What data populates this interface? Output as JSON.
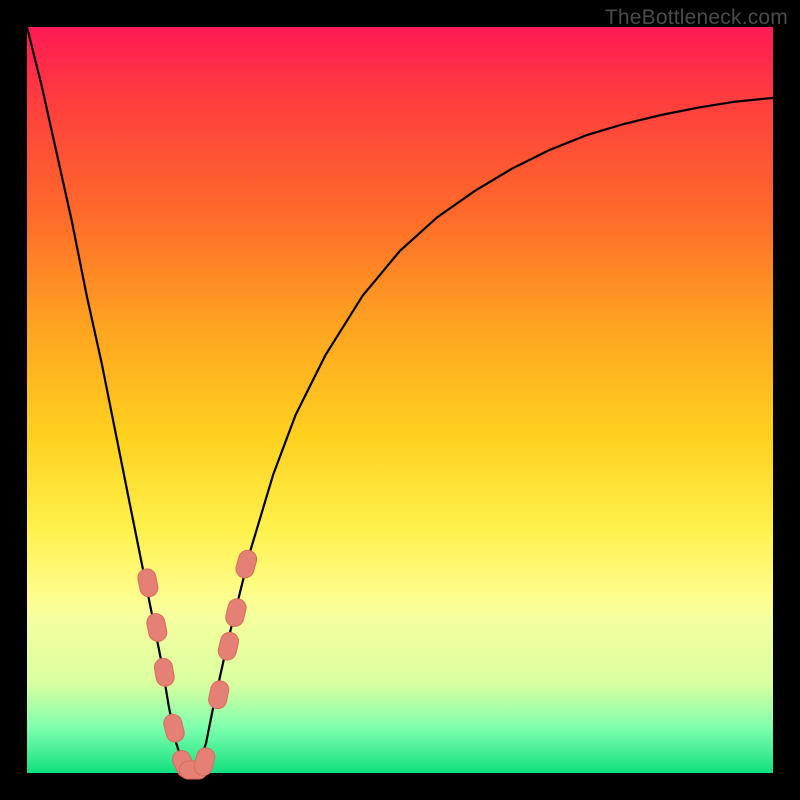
{
  "watermark": "TheBottleneck.com",
  "colors": {
    "frame": "#000000",
    "curve": "#000000",
    "marker_fill": "#e58074",
    "marker_stroke": "#d86b5f",
    "gradient_stops": [
      "#ff1a55",
      "#ff3e3e",
      "#ff6a2a",
      "#ffa321",
      "#ffd11f",
      "#fff04a",
      "#fffd8c",
      "#f5ff9e",
      "#d9ffa0",
      "#7dffad",
      "#12e07e"
    ]
  },
  "chart_data": {
    "type": "line",
    "title": "",
    "xlabel": "",
    "ylabel": "",
    "xlim": [
      0,
      100
    ],
    "ylim": [
      0,
      100
    ],
    "legend": false,
    "grid": false,
    "series": [
      {
        "name": "bottleneck-curve",
        "x": [
          0,
          2,
          4,
          6,
          8,
          10,
          12,
          14,
          16,
          17,
          18,
          19,
          20,
          21,
          22,
          23,
          24,
          25,
          27,
          30,
          33,
          36,
          40,
          45,
          50,
          55,
          60,
          65,
          70,
          75,
          80,
          85,
          90,
          95,
          100
        ],
        "y": [
          100,
          92,
          83,
          74,
          64,
          55,
          45,
          35,
          25,
          20,
          15,
          9,
          4,
          1,
          0,
          1,
          4,
          9,
          18,
          30,
          40,
          48,
          56,
          64,
          70,
          74.5,
          78,
          81,
          83.5,
          85.5,
          87,
          88.2,
          89.2,
          90,
          90.5
        ]
      }
    ],
    "markers": [
      {
        "name": "left-dot-1",
        "x": 16.2,
        "y": 25.5
      },
      {
        "name": "left-dot-2",
        "x": 17.4,
        "y": 19.5
      },
      {
        "name": "left-dot-3",
        "x": 18.4,
        "y": 13.5
      },
      {
        "name": "left-dot-4",
        "x": 19.7,
        "y": 6.0
      },
      {
        "name": "min-dot-1",
        "x": 21.0,
        "y": 1.2
      },
      {
        "name": "min-dot-2",
        "x": 22.3,
        "y": 0.4
      },
      {
        "name": "min-dot-3",
        "x": 23.8,
        "y": 1.5
      },
      {
        "name": "right-dot-1",
        "x": 25.7,
        "y": 10.5
      },
      {
        "name": "right-dot-2",
        "x": 27.0,
        "y": 17.0
      },
      {
        "name": "right-dot-3",
        "x": 28.0,
        "y": 21.5
      },
      {
        "name": "right-dot-4",
        "x": 29.4,
        "y": 28.0
      }
    ],
    "minimum": {
      "x": 22,
      "y": 0
    }
  }
}
